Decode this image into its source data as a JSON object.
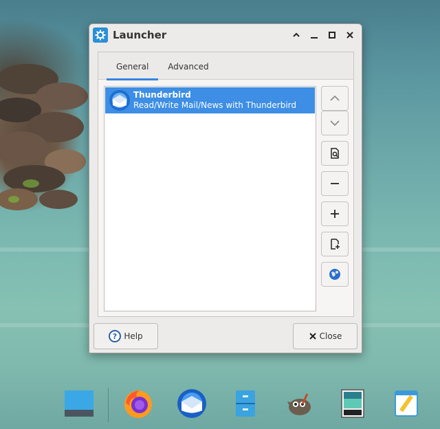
{
  "window": {
    "title": "Launcher",
    "tabs": [
      {
        "label": "General",
        "active": true
      },
      {
        "label": "Advanced",
        "active": false
      }
    ],
    "list_items": [
      {
        "name": "Thunderbird",
        "description": "Read/Write Mail/News with Thunderbird",
        "icon": "thunderbird-icon",
        "selected": true
      }
    ],
    "side_buttons": [
      "move-up-icon",
      "move-down-icon",
      "edit-item-icon",
      "remove-item-icon",
      "add-item-icon",
      "new-empty-item-icon",
      "globe-icon"
    ],
    "footer": {
      "help_label": "Help",
      "close_label": "Close"
    }
  },
  "dock": {
    "items": [
      "desktop-icon",
      "firefox-icon",
      "thunderbird-icon",
      "file-manager-icon",
      "gimp-icon",
      "image-viewer-icon",
      "text-editor-icon"
    ]
  },
  "colors": {
    "selection": "#3d8ee4",
    "tab_underline": "#3584e4",
    "app_icon_bg": "#2a8fd8"
  }
}
